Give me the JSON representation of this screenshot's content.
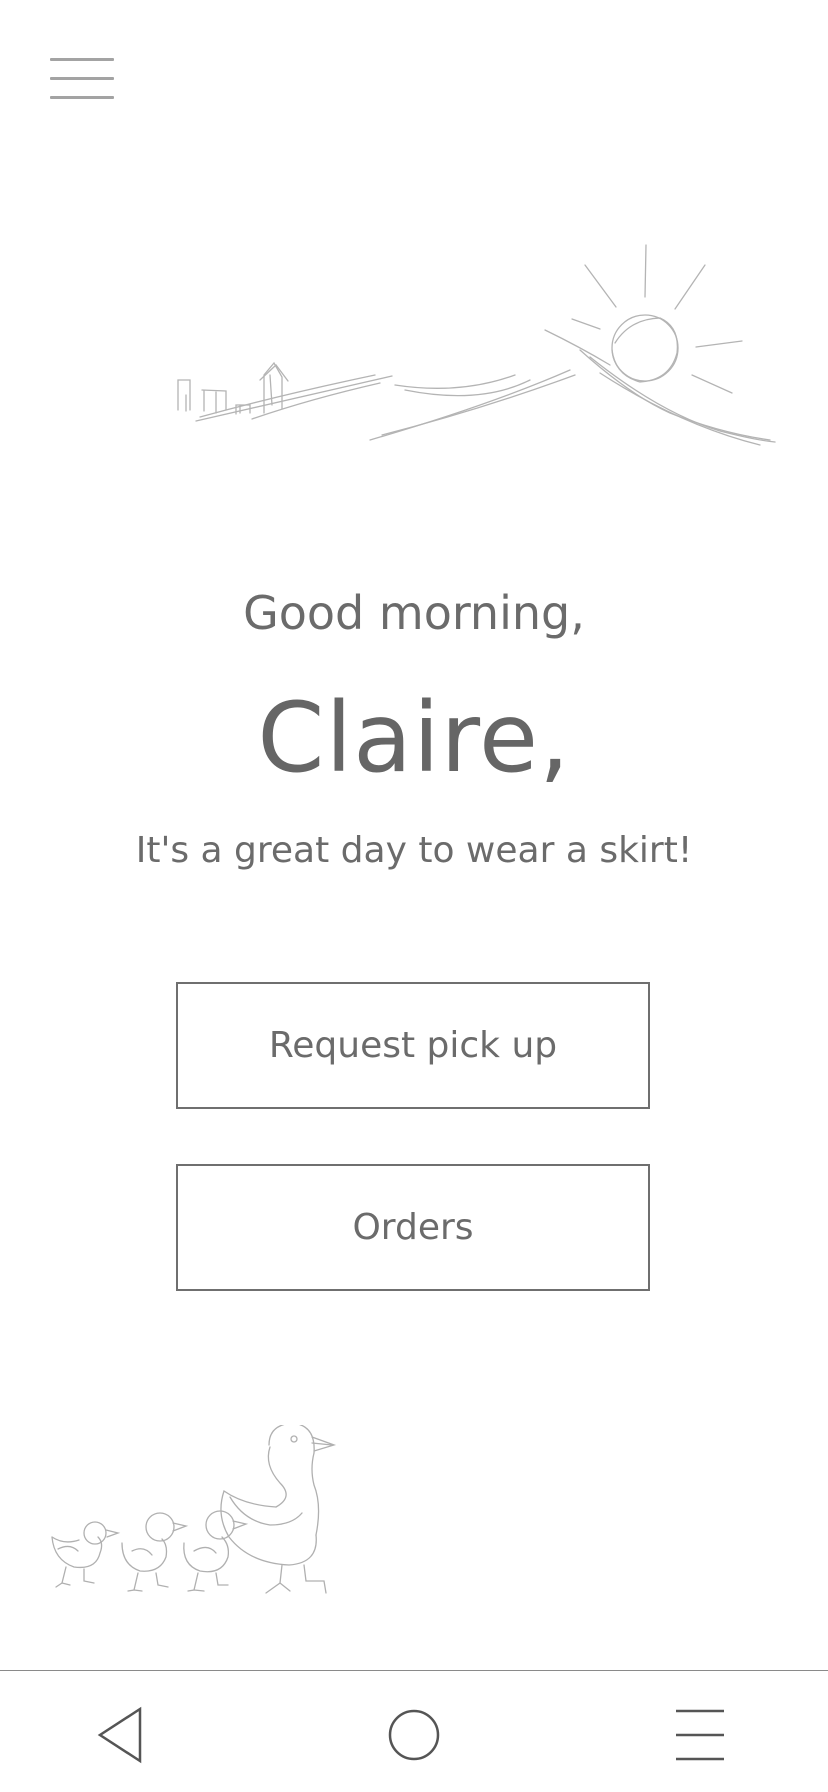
{
  "header": {
    "menu_icon": "hamburger-menu-icon"
  },
  "hero": {
    "illustration": "sunrise-over-hills-sketch"
  },
  "greeting": {
    "salutation": "Good morning,",
    "name": "Claire,",
    "message": "It's a great day to wear a skirt!"
  },
  "actions": {
    "request_pickup_label": "Request pick up",
    "orders_label": "Orders"
  },
  "footer_art": {
    "illustration": "duck-and-ducklings-sketch"
  },
  "system_nav": {
    "back_icon": "back-triangle-icon",
    "home_icon": "home-circle-icon",
    "recents_icon": "menu-lines-icon"
  },
  "colors": {
    "text": "#6b6b6b",
    "sketch_line": "#b0b0b0",
    "button_border": "#6f6f6f",
    "menu_icon": "#a3a3a3"
  }
}
